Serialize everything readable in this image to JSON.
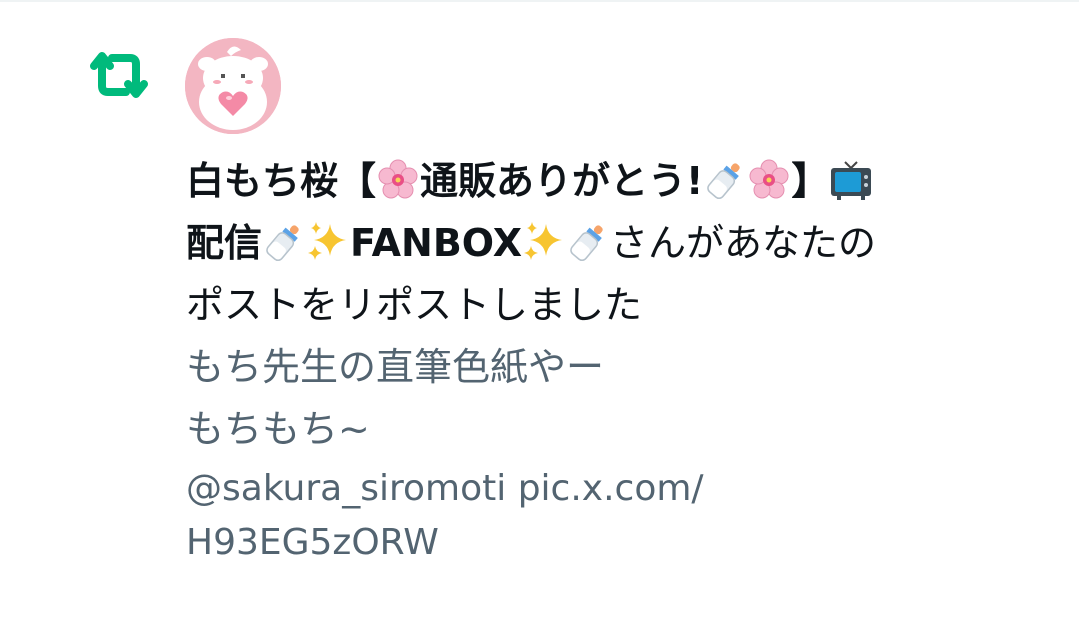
{
  "notification": {
    "icon": "retweet-icon",
    "icon_color": "#00ba7c",
    "avatar": "user-avatar",
    "name_parts": {
      "p1": "白もち桜【",
      "p2": "通販ありがとう!",
      "p3": "】",
      "p4": "配信",
      "p5": "FANBOX"
    },
    "action_text_line1": "さんがあなたの",
    "action_text_line2": "ポストをリポストしました",
    "emojis": [
      "cherry-blossom",
      "baby-bottle",
      "cherry-blossom",
      "television",
      "baby-bottle",
      "sparkles",
      "sparkles",
      "baby-bottle"
    ]
  },
  "quoted_post": {
    "text_line1": "もち先生の直筆色紙やー",
    "text_line2": "もちもち~",
    "mention": "@sakura_siromoti",
    "link_part1": "pic.x.com/",
    "link_part2": "H93EG5zORW"
  },
  "colors": {
    "text_primary": "#0f1419",
    "text_secondary": "#536471",
    "retweet_green": "#00ba7c"
  }
}
